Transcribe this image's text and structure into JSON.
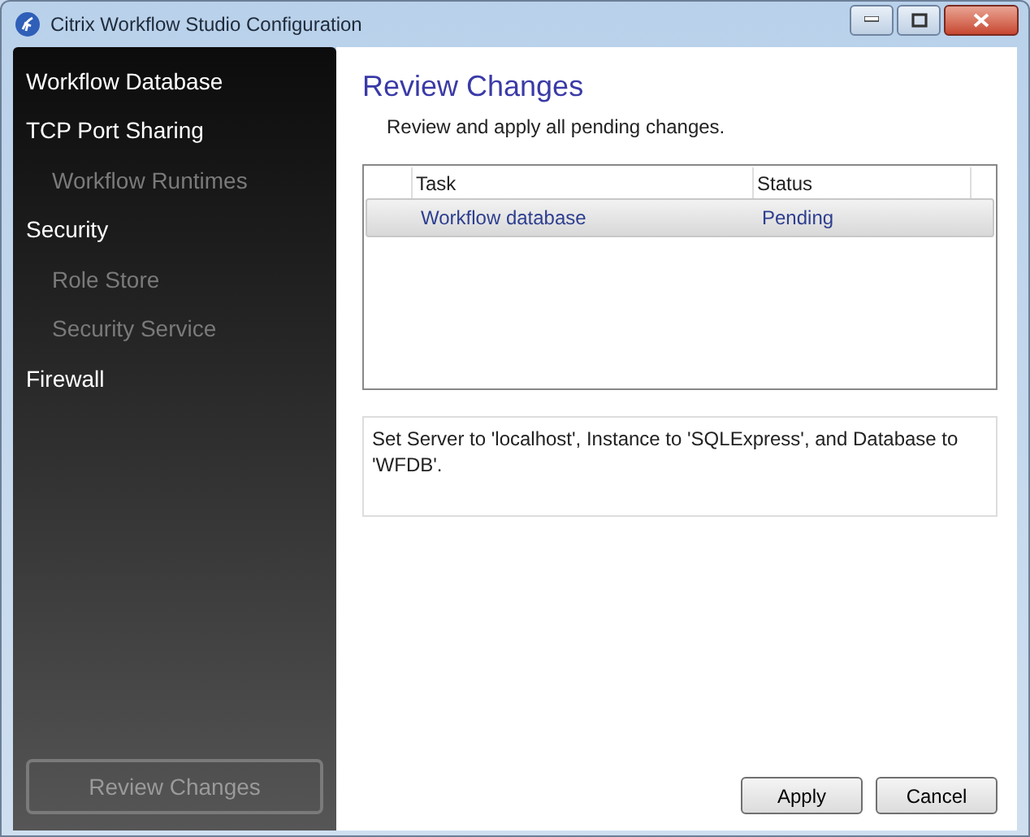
{
  "window": {
    "title": "Citrix Workflow Studio Configuration"
  },
  "sidebar": {
    "items": [
      {
        "label": "Workflow Database",
        "disabled": false
      },
      {
        "label": "TCP Port Sharing",
        "disabled": false,
        "children": [
          {
            "label": "Workflow Runtimes",
            "disabled": true
          }
        ]
      },
      {
        "label": "Security",
        "disabled": false,
        "children": [
          {
            "label": "Role Store",
            "disabled": true
          },
          {
            "label": "Security Service",
            "disabled": true
          }
        ]
      },
      {
        "label": "Firewall",
        "disabled": false
      }
    ],
    "review_button": {
      "label": "Review Changes",
      "disabled": true
    }
  },
  "page": {
    "title": "Review Changes",
    "subtitle": "Review and apply all pending changes."
  },
  "table": {
    "columns": [
      "Task",
      "Status"
    ],
    "rows": [
      {
        "task": "Workflow database",
        "status": "Pending",
        "selected": true
      }
    ]
  },
  "description": "Set Server to 'localhost', Instance to 'SQLExpress', and Database to 'WFDB'.",
  "buttons": [
    "Apply",
    "Cancel"
  ]
}
